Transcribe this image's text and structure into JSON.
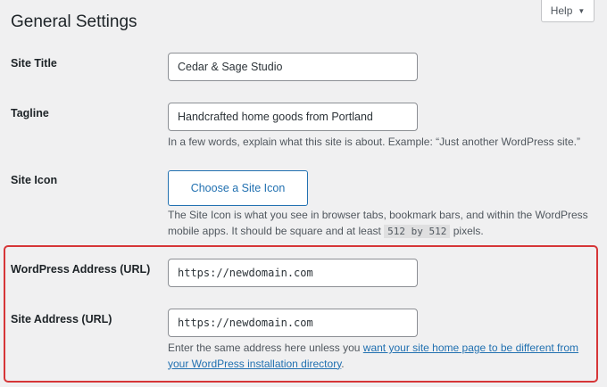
{
  "page": {
    "title": "General Settings"
  },
  "help": {
    "label": "Help",
    "caret": "▼"
  },
  "fields": {
    "site_title": {
      "label": "Site Title",
      "value": "Cedar & Sage Studio"
    },
    "tagline": {
      "label": "Tagline",
      "value": "Handcrafted home goods from Portland",
      "description": "In a few words, explain what this site is about. Example: “Just another WordPress site.”"
    },
    "site_icon": {
      "label": "Site Icon",
      "button_label": "Choose a Site Icon",
      "description_before": "The Site Icon is what you see in browser tabs, bookmark bars, and within the WordPress mobile apps. It should be square and at least ",
      "description_code": "512 by 512",
      "description_after": " pixels."
    },
    "wordpress_address": {
      "label": "WordPress Address (URL)",
      "value": "https://newdomain.com"
    },
    "site_address": {
      "label": "Site Address (URL)",
      "value": "https://newdomain.com",
      "description_before": "Enter the same address here unless you ",
      "description_link": "want your site home page to be different from your WordPress installation directory",
      "description_after": "."
    }
  },
  "colors": {
    "background": "#f0f0f1",
    "accent": "#2271b1",
    "highlight": "#d63638"
  }
}
